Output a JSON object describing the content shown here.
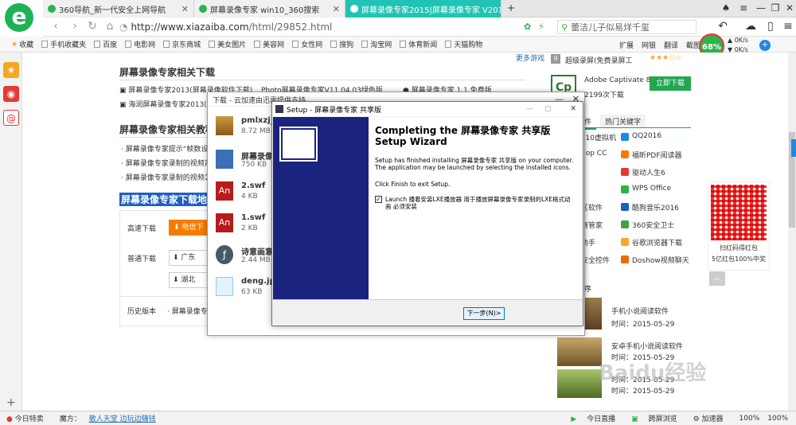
{
  "tabs": [
    {
      "label": "360导航_新一代安全上网导航",
      "icon_color": "#2cb34a",
      "active": false
    },
    {
      "label": "屏幕录像专家 win10_360搜索",
      "icon_color": "#2cb34a",
      "active": false
    },
    {
      "label": "屏幕录像专家2015|屏幕录像专家 V201",
      "icon_color": "#ffffff",
      "active": true
    }
  ],
  "new_tab": "+",
  "window_controls": {
    "skin": "♠",
    "menu": "≡",
    "min": "—",
    "max": "❐",
    "close": "✕"
  },
  "address": {
    "host": "http://www.xiazaiba.com",
    "path": "/html/29852.html"
  },
  "search": {
    "value": "蕾洁儿子似易烊千玺"
  },
  "bookmarks": [
    "收藏",
    "手机收藏夹",
    "百度",
    "电影网",
    "京东商城",
    "美女图片",
    "美容网",
    "女性网",
    "搜狗",
    "淘宝网",
    "体育新闻",
    "天猫购物"
  ],
  "bookmarks_right": [
    "扩展",
    "网银",
    "翻译",
    "截图"
  ],
  "speed": {
    "percent": "68%",
    "up": "0K/s",
    "down": "0K/s"
  },
  "page": {
    "more_link": "更多游戏",
    "section1_title": "屏幕录像专家相关下载",
    "related": [
      "屏幕录像专家2013(屏幕录像软件下载)",
      "海润屏幕录像专家2013(屏",
      "Photo屏幕录像专家V11.04.03绿色版",
      "屏幕录像专家 1.1 免费版"
    ],
    "section2_title": "屏幕录像专家相关教程",
    "tutorials": [
      "屏幕录像专家提示“帧数设",
      "屏幕录像专家录制的视频声",
      "屏幕录像专家录制的视频怎"
    ],
    "section3_title": "屏幕录像专家下载地址",
    "high_speed_label": "高速下载",
    "telecom_btn": "电信下",
    "normal_label": "普通下载",
    "mirror1": "广东",
    "mirror2": "湖北",
    "history_label": "历史版本",
    "history_item": "屏幕录像专"
  },
  "download_dialog": {
    "title": "下载 - 云加速由迅雷提供支持",
    "items": [
      {
        "name": "pmlxzj_2",
        "size": "8.72 MB"
      },
      {
        "name": "屏幕录像",
        "size": "750 KB"
      },
      {
        "name": "2.swf",
        "size": "4 KB"
      },
      {
        "name": "1.swf",
        "size": "2 KB"
      },
      {
        "name": "诗意画意",
        "size": "2.44 MB"
      },
      {
        "name": "deng.jpg",
        "size": "63 KB"
      }
    ],
    "close": "✕",
    "minimize": "—"
  },
  "setup": {
    "title": "Setup - 屏幕录像专家 共享版",
    "heading": "Completing the 屏幕录像专家 共享版 Setup Wizard",
    "body": "Setup has finished installing 屏幕录像专家 共享版 on your computer. The application may be launched by selecting the installed icons.",
    "finish_hint": "Click Finish to exit Setup.",
    "checkbox_label": "Launch 播着安装LXE播放器 用于播放屏幕录像专家录制的LXE格式动画 必须安装",
    "checkbox_checked": true,
    "next_button": "下一步(N)>"
  },
  "right_panel": {
    "rank_num": "9",
    "top_item": "超级录屏(免费录屏工",
    "stars": "★★★☆☆",
    "app_name": "Adobe Captivate 8",
    "app_sub": "2199次下载",
    "download_btn": "立即下载",
    "tab1": "件",
    "tab2": "热门关键字",
    "keywords": [
      [
        "e10虚拟机",
        "QQ2016"
      ],
      [
        "hop CC",
        "福昕PDF阅读器"
      ],
      [
        "",
        "驱动人生6"
      ],
      [
        "",
        "WPS Office"
      ],
      [
        "区软件",
        "酷狗音乐2016"
      ],
      [
        "商管家",
        "360安全卫士"
      ],
      [
        "助手",
        "谷歌浏览器下载"
      ],
      [
        "安全控件",
        "Doshow视频聊天"
      ]
    ],
    "news_label": "序",
    "news": [
      {
        "title": "手机小说阅读软件",
        "date": "时间：2015-05-29"
      },
      {
        "title": "安卓手机小说阅读软件",
        "date": "时间：2015-05-29"
      },
      {
        "title": "",
        "date": "时间：2015-05-29"
      },
      {
        "title": "",
        "date": "时间：2015-05-29"
      }
    ]
  },
  "qr": {
    "caption1": "扫红码得红包",
    "caption2": "5亿红包100%中奖"
  },
  "status": {
    "left": [
      "今日特卖",
      "魔方：",
      "散人天堂 边玩边赚钱"
    ],
    "right": [
      "今日直播",
      "跨屏浏览",
      "加速器",
      "100%",
      "100%"
    ]
  },
  "watermark": "Baidu经验",
  "colors": {
    "accent": "#21c4b4",
    "green": "#2cb34a",
    "orange": "#f57c00",
    "setup_blue": "#1a237e"
  }
}
